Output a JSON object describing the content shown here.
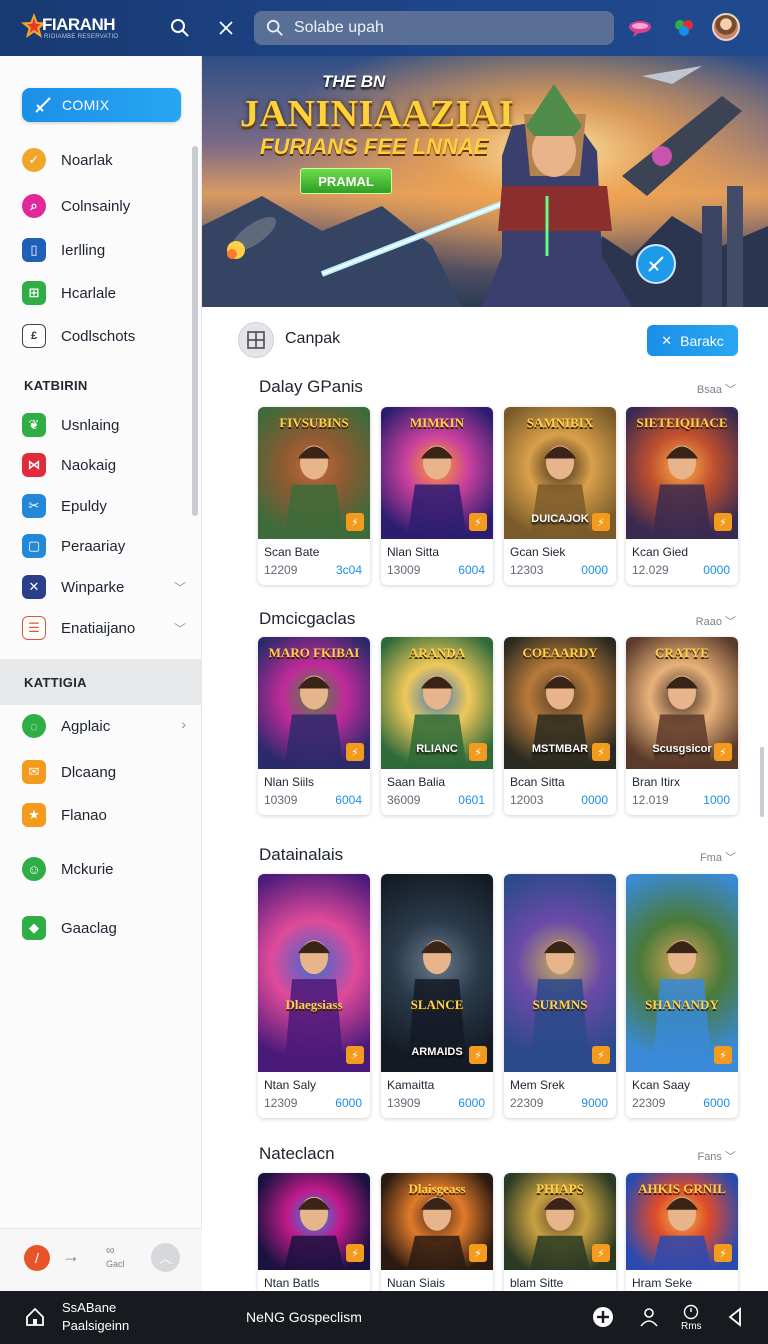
{
  "header": {
    "logo_text": "FIARANH",
    "logo_sub": "RIOIAMBE RESERVATIO",
    "search_placeholder": "Solabe upah",
    "colors": {
      "bar": "#1e4588",
      "accent": "#1a8ee8"
    }
  },
  "sidebar": {
    "primary_button": "COMIX",
    "items_top": [
      {
        "label": "Noarlak",
        "icon": "check-badge-icon",
        "color": "#f0a62a"
      },
      {
        "label": "Colnsainly",
        "icon": "search-circle-icon",
        "color": "#e0289a"
      },
      {
        "label": "Ierlling",
        "icon": "book-icon",
        "color": "#1f5fb8"
      },
      {
        "label": "Hcarlale",
        "icon": "grid-icon",
        "color": "#2fae45"
      },
      {
        "label": "Codlschots",
        "icon": "document-icon",
        "color": "#ffffff"
      }
    ],
    "heading_1": "KATBIRIN",
    "items_mid": [
      {
        "label": "Usnlaing",
        "icon": "leaf-icon",
        "color": "#2fae45"
      },
      {
        "label": "Naokaig",
        "icon": "bookmark-icon",
        "color": "#e02c3a"
      },
      {
        "label": "Epuldy",
        "icon": "tools-icon",
        "color": "#2488d8"
      },
      {
        "label": "Peraariay",
        "icon": "square-icon",
        "color": "#2488d8"
      },
      {
        "label": "Winparke",
        "icon": "cross-icon",
        "color": "#2a3f8c",
        "chevron": "down"
      },
      {
        "label": "Enatiaijano",
        "icon": "calendar-icon",
        "color": "#e8542a",
        "chevron": "down"
      }
    ],
    "heading_2": "KATTIGIA",
    "items_bottom": [
      {
        "label": "Agplaic",
        "icon": "chat-icon",
        "color": "#2fae45",
        "chevron": "right"
      },
      {
        "label": "Dlcaang",
        "icon": "mail-icon",
        "color": "#f29b1c"
      },
      {
        "label": "Flanao",
        "icon": "star-icon",
        "color": "#f29b1c"
      },
      {
        "label": "Mckurie",
        "icon": "robot-icon",
        "color": "#2fae45"
      },
      {
        "label": "Gaaclag",
        "icon": "gamepad-icon",
        "color": "#2fae45"
      }
    ],
    "bottom_label": "Gacl"
  },
  "banner": {
    "line1": "THE BN",
    "line2": "JANINIAAZIAI",
    "line3": "FURIANS FEE LNNAE",
    "button": "PRAMAL"
  },
  "profile_row": {
    "name": "Canpak",
    "button": "Barakc"
  },
  "sections": [
    {
      "title": "Dalay GPanis",
      "more": "Bsaa",
      "cards": [
        {
          "art": "FIVSUBINS",
          "name": "Scan Bate",
          "num": "12209",
          "val": "3c04"
        },
        {
          "art": "MIMKIN",
          "name": "Nlan Sitta",
          "num": "13009",
          "val": "6004"
        },
        {
          "art": "SAMNIBIX",
          "name": "Gcan Siek",
          "num": "12303",
          "val": "0000",
          "sub": "DUICAJOK"
        },
        {
          "art": "SIETEIQIIACE",
          "name": "Kcan Gied",
          "num": "12.029",
          "val": "0000"
        }
      ]
    },
    {
      "title": "Dmcicgaclas",
      "more": "Raao",
      "cards": [
        {
          "art": "MARO FKIBAI",
          "name": "Nlan Siils",
          "num": "10309",
          "val": "6004"
        },
        {
          "art": "ARANDA",
          "name": "Saan Balia",
          "num": "36009",
          "val": "0601",
          "sub": "RLIANC"
        },
        {
          "art": "COEAARDY",
          "name": "Bcan Sitta",
          "num": "12003",
          "val": "0000",
          "sub": "MSTMBAR"
        },
        {
          "art": "CRATYE",
          "name": "Bran Itirx",
          "num": "12.019",
          "val": "1000",
          "sub": "Scusgsicor"
        }
      ]
    },
    {
      "title": "Datainalais",
      "more": "Fma",
      "cards": [
        {
          "art": "Dlaegsiass",
          "name": "Ntan Saly",
          "num": "12309",
          "val": "6000"
        },
        {
          "art": "SLANCE",
          "name": "Kamaitta",
          "num": "13909",
          "val": "6000",
          "sub": "ARMAIDS"
        },
        {
          "art": "SURMNS",
          "name": "Mem Srek",
          "num": "22309",
          "val": "9000"
        },
        {
          "art": "SHANANDY",
          "name": "Kcan Saay",
          "num": "22309",
          "val": "6000"
        }
      ]
    },
    {
      "title": "Nateclacn",
      "more": "Fans",
      "cards": [
        {
          "art": "",
          "name": "Ntan Batls",
          "num": "",
          "val": ""
        },
        {
          "art": "Dlaisgeass",
          "name": "Nuan Siais",
          "num": "",
          "val": ""
        },
        {
          "art": "PHIAPS",
          "name": "blam Sitte",
          "num": "",
          "val": ""
        },
        {
          "art": "AHKIS GRNIL",
          "name": "Hram Seke",
          "num": "",
          "val": ""
        }
      ]
    }
  ],
  "bottom_nav": {
    "line1": "SsABane",
    "line2": "Paalsigeinn",
    "center": "NeNG Gospeclism",
    "rms": "Rms"
  }
}
